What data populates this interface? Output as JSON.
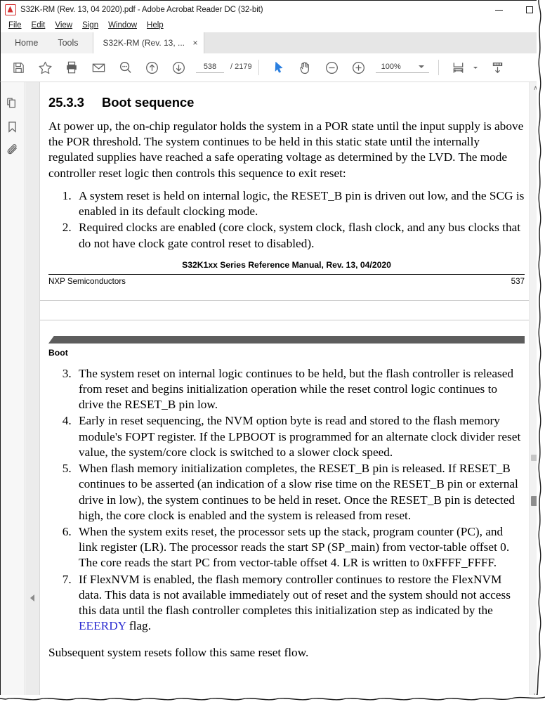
{
  "window": {
    "title": "S32K-RM (Rev. 13, 04 2020).pdf - Adobe Acrobat Reader DC (32-bit)",
    "app_icon": "acrobat-icon",
    "minimize_label": "Minimize",
    "restore_label": "Restore"
  },
  "menubar": {
    "items": [
      {
        "label": "File"
      },
      {
        "label": "Edit"
      },
      {
        "label": "View"
      },
      {
        "label": "Sign"
      },
      {
        "label": "Window"
      },
      {
        "label": "Help"
      }
    ]
  },
  "tabstrip": {
    "home_label": "Home",
    "tools_label": "Tools",
    "doc_tab_label": "S32K-RM (Rev. 13, ...",
    "close_glyph": "×"
  },
  "toolbar": {
    "save_icon": "save-icon",
    "star_icon": "star-icon",
    "print_icon": "print-icon",
    "email_icon": "email-icon",
    "search_icon": "search-icon",
    "prev_page_icon": "arrow-up-circle-icon",
    "next_page_icon": "arrow-down-circle-icon",
    "page_current": "538",
    "page_separator": "/",
    "page_total": "2179",
    "select_icon": "cursor-select-icon",
    "hand_icon": "hand-pan-icon",
    "zoom_out_icon": "zoom-out-icon",
    "zoom_in_icon": "zoom-in-icon",
    "zoom_level": "100%",
    "fit_page_icon": "fit-page-icon",
    "scroll_mode_icon": "page-fit-width-icon"
  },
  "leftrail": {
    "items": [
      {
        "icon": "page-thumbnails-icon",
        "label": "Page Thumbnails"
      },
      {
        "icon": "bookmark-icon",
        "label": "Bookmarks"
      },
      {
        "icon": "paperclip-attachment-icon",
        "label": "Attachments"
      }
    ],
    "collapse_handle": "collapse-panel-handle"
  },
  "document": {
    "page_537": {
      "section_number": "25.3.3",
      "section_title": "Boot sequence",
      "intro": "At power up, the on-chip regulator holds the system in a POR state until the input supply is above the POR threshold. The system continues to be held in this static state until the internally regulated supplies have reached a safe operating voltage as determined by the LVD. The mode controller reset logic then controls this sequence to exit reset:",
      "steps": [
        "A system reset is held on internal logic, the RESET_B pin is driven out low, and the SCG is enabled in its default clocking mode.",
        "Required clocks are enabled (core clock, system clock, flash clock, and any bus clocks that do not have clock gate control reset to disabled)."
      ],
      "footer_title": "S32K1xx Series Reference Manual, Rev. 13, 04/2020",
      "footer_left": "NXP Semiconductors",
      "footer_right": "537"
    },
    "page_538": {
      "banner_label": "Boot",
      "steps_start": 3,
      "steps": [
        "The system reset on internal logic continues to be held, but the flash controller is released from reset and begins initialization operation while the reset control logic continues to drive the RESET_B pin low.",
        "Early in reset sequencing, the NVM option byte is read and stored to the flash memory module's FOPT register. If the LPBOOT is programmed for an alternate clock divider reset value, the system/core clock is switched to a slower clock speed.",
        "When flash memory initialization completes, the RESET_B pin is released. If RESET_B continues to be asserted (an indication of a slow rise time on the RESET_B pin or external drive in low), the system continues to be held in reset. Once the RESET_B pin is detected high, the core clock is enabled and the system is released from reset.",
        "When the system exits reset, the processor sets up the stack, program counter (PC), and link register (LR). The processor reads the start SP (SP_main) from vector-table offset 0. The core reads the start PC from vector-table offset 4. LR is written to 0xFFFF_FFFF."
      ],
      "step7_prefix": "If FlexNVM is enabled, the flash memory controller continues to restore the FlexNVM data. This data is not available immediately out of reset and the system should not access this data until the flash controller completes this initialization step as indicated by the ",
      "step7_link": "EEERDY",
      "step7_suffix": " flag.",
      "closing": "Subsequent system resets follow this same reset flow."
    }
  },
  "scrollbar": {
    "up_arrow": "∧",
    "down_arrow": "∨"
  },
  "colors": {
    "link": "#2a2ad0",
    "banner": "#5d5d5d",
    "accent_blue": "#2a7fe0",
    "icon_gray": "#565656",
    "acrobat_red": "#d32f2f"
  }
}
